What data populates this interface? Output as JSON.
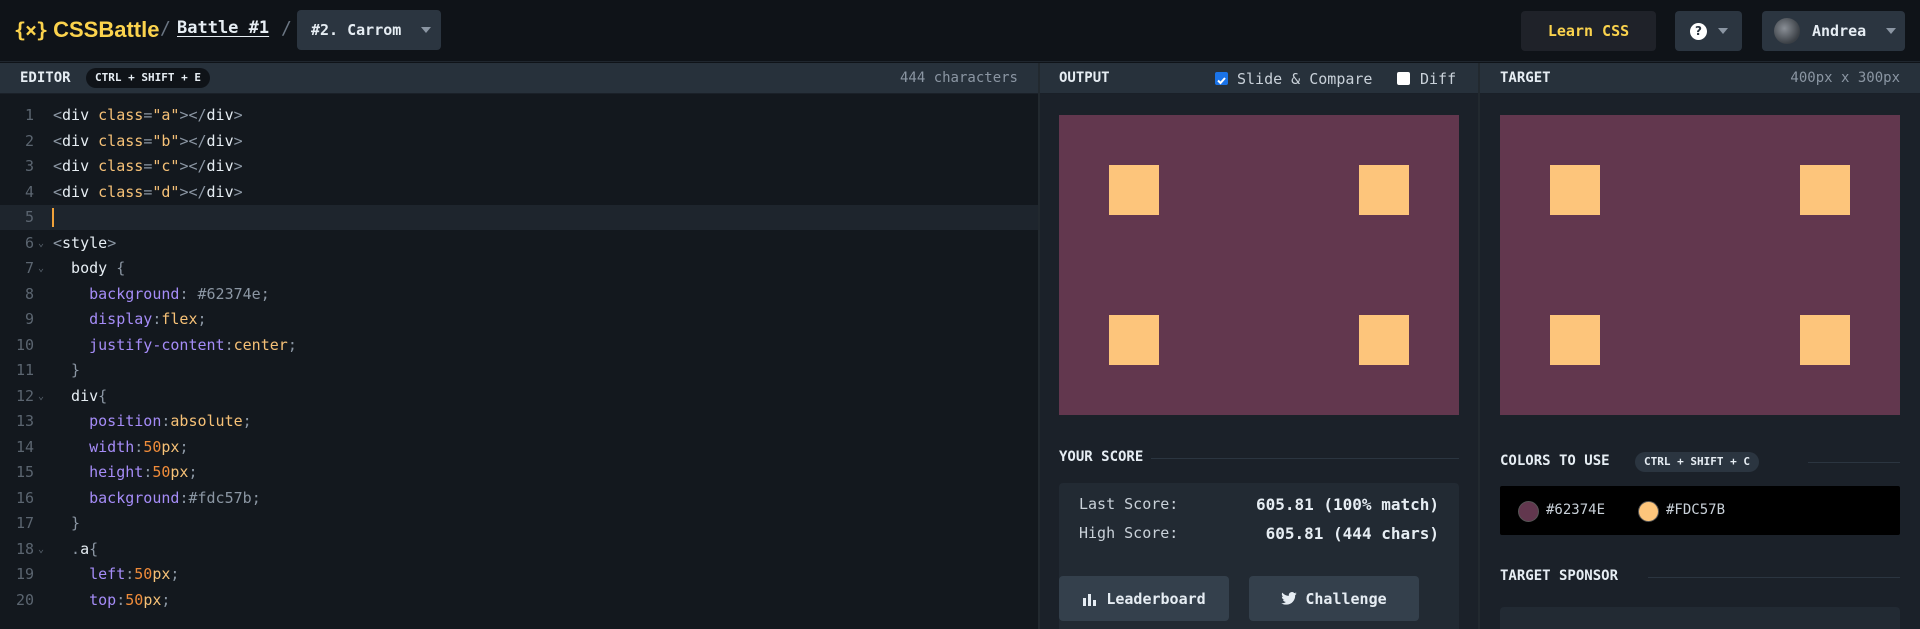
{
  "header": {
    "logo_mark": "{×}",
    "logo_text": "CSSBattle",
    "separator": "/",
    "battle_link": "Battle #1",
    "target_select": "#2. Carrom",
    "learn_button": "Learn CSS",
    "help_glyph": "?",
    "user_name": "Andrea"
  },
  "editor": {
    "title": "EDITOR",
    "shortcut": "CTRL + SHIFT + E",
    "char_count": "444 characters",
    "active_line": 5,
    "lines": [
      {
        "n": "1",
        "fold": false,
        "tokens": [
          [
            "punc",
            "<"
          ],
          [
            "tag",
            "div"
          ],
          [
            "punc",
            " "
          ],
          [
            "attr",
            "class"
          ],
          [
            "punc",
            "="
          ],
          [
            "str",
            "\"a\""
          ],
          [
            "punc",
            "></"
          ],
          [
            "tag",
            "div"
          ],
          [
            "punc",
            ">"
          ]
        ]
      },
      {
        "n": "2",
        "fold": false,
        "tokens": [
          [
            "punc",
            "<"
          ],
          [
            "tag",
            "div"
          ],
          [
            "punc",
            " "
          ],
          [
            "attr",
            "class"
          ],
          [
            "punc",
            "="
          ],
          [
            "str",
            "\"b\""
          ],
          [
            "punc",
            "></"
          ],
          [
            "tag",
            "div"
          ],
          [
            "punc",
            ">"
          ]
        ]
      },
      {
        "n": "3",
        "fold": false,
        "tokens": [
          [
            "punc",
            "<"
          ],
          [
            "tag",
            "div"
          ],
          [
            "punc",
            " "
          ],
          [
            "attr",
            "class"
          ],
          [
            "punc",
            "="
          ],
          [
            "str",
            "\"c\""
          ],
          [
            "punc",
            "></"
          ],
          [
            "tag",
            "div"
          ],
          [
            "punc",
            ">"
          ]
        ]
      },
      {
        "n": "4",
        "fold": false,
        "tokens": [
          [
            "punc",
            "<"
          ],
          [
            "tag",
            "div"
          ],
          [
            "punc",
            " "
          ],
          [
            "attr",
            "class"
          ],
          [
            "punc",
            "="
          ],
          [
            "str",
            "\"d\""
          ],
          [
            "punc",
            "></"
          ],
          [
            "tag",
            "div"
          ],
          [
            "punc",
            ">"
          ]
        ]
      },
      {
        "n": "5",
        "fold": false,
        "tokens": []
      },
      {
        "n": "6",
        "fold": true,
        "tokens": [
          [
            "punc",
            "<"
          ],
          [
            "tag",
            "style"
          ],
          [
            "punc",
            ">"
          ]
        ]
      },
      {
        "n": "7",
        "fold": true,
        "tokens": [
          [
            "sel",
            "  body "
          ],
          [
            "punc",
            "{"
          ]
        ]
      },
      {
        "n": "8",
        "fold": false,
        "tokens": [
          [
            "prop",
            "    background"
          ],
          [
            "punc",
            ": "
          ],
          [
            "hex",
            "#62374e"
          ],
          [
            "punc",
            ";"
          ]
        ]
      },
      {
        "n": "9",
        "fold": false,
        "tokens": [
          [
            "prop",
            "    display"
          ],
          [
            "punc",
            ":"
          ],
          [
            "val",
            "flex"
          ],
          [
            "punc",
            ";"
          ]
        ]
      },
      {
        "n": "10",
        "fold": false,
        "tokens": [
          [
            "prop",
            "    justify-content"
          ],
          [
            "punc",
            ":"
          ],
          [
            "val",
            "center"
          ],
          [
            "punc",
            ";"
          ]
        ]
      },
      {
        "n": "11",
        "fold": false,
        "tokens": [
          [
            "punc",
            "  }"
          ]
        ]
      },
      {
        "n": "12",
        "fold": true,
        "tokens": [
          [
            "sel",
            "  div"
          ],
          [
            "punc",
            "{"
          ]
        ]
      },
      {
        "n": "13",
        "fold": false,
        "tokens": [
          [
            "prop",
            "    position"
          ],
          [
            "punc",
            ":"
          ],
          [
            "val",
            "absolute"
          ],
          [
            "punc",
            ";"
          ]
        ]
      },
      {
        "n": "14",
        "fold": false,
        "tokens": [
          [
            "prop",
            "    width"
          ],
          [
            "punc",
            ":"
          ],
          [
            "num",
            "50"
          ],
          [
            "val",
            "px"
          ],
          [
            "punc",
            ";"
          ]
        ]
      },
      {
        "n": "15",
        "fold": false,
        "tokens": [
          [
            "prop",
            "    height"
          ],
          [
            "punc",
            ":"
          ],
          [
            "num",
            "50"
          ],
          [
            "val",
            "px"
          ],
          [
            "punc",
            ";"
          ]
        ]
      },
      {
        "n": "16",
        "fold": false,
        "tokens": [
          [
            "prop",
            "    background"
          ],
          [
            "punc",
            ":"
          ],
          [
            "hex",
            "#fdc57b"
          ],
          [
            "punc",
            ";"
          ]
        ]
      },
      {
        "n": "17",
        "fold": false,
        "tokens": [
          [
            "punc",
            "  }"
          ]
        ]
      },
      {
        "n": "18",
        "fold": true,
        "tokens": [
          [
            "punc",
            "  ."
          ],
          [
            "sel",
            "a"
          ],
          [
            "punc",
            "{"
          ]
        ]
      },
      {
        "n": "19",
        "fold": false,
        "tokens": [
          [
            "prop",
            "    left"
          ],
          [
            "punc",
            ":"
          ],
          [
            "num",
            "50"
          ],
          [
            "val",
            "px"
          ],
          [
            "punc",
            ";"
          ]
        ]
      },
      {
        "n": "20",
        "fold": false,
        "tokens": [
          [
            "prop",
            "    top"
          ],
          [
            "punc",
            ":"
          ],
          [
            "num",
            "50"
          ],
          [
            "val",
            "px"
          ],
          [
            "punc",
            ";"
          ]
        ]
      }
    ]
  },
  "output": {
    "title": "OUTPUT",
    "slide_compare": "Slide & Compare",
    "slide_compare_checked": true,
    "diff": "Diff",
    "diff_checked": false
  },
  "target": {
    "title": "TARGET",
    "size": "400px x 300px"
  },
  "score": {
    "title": "YOUR SCORE",
    "last_label": "Last Score:",
    "last_value": "605.81 (100% match)",
    "high_label": "High Score:",
    "high_value": "605.81 (444 chars)",
    "leaderboard": "Leaderboard",
    "challenge": "Challenge"
  },
  "colors": {
    "title": "COLORS TO USE",
    "shortcut": "CTRL + SHIFT + C",
    "swatches": [
      {
        "hex": "#62374E",
        "color": "#62374e"
      },
      {
        "hex": "#FDC57B",
        "color": "#fdc57b"
      }
    ]
  },
  "sponsor": {
    "title": "TARGET SPONSOR"
  },
  "theme": {
    "canvas_bg": "#62374e",
    "square": "#fdc57b",
    "accent": "#fbd34d"
  }
}
